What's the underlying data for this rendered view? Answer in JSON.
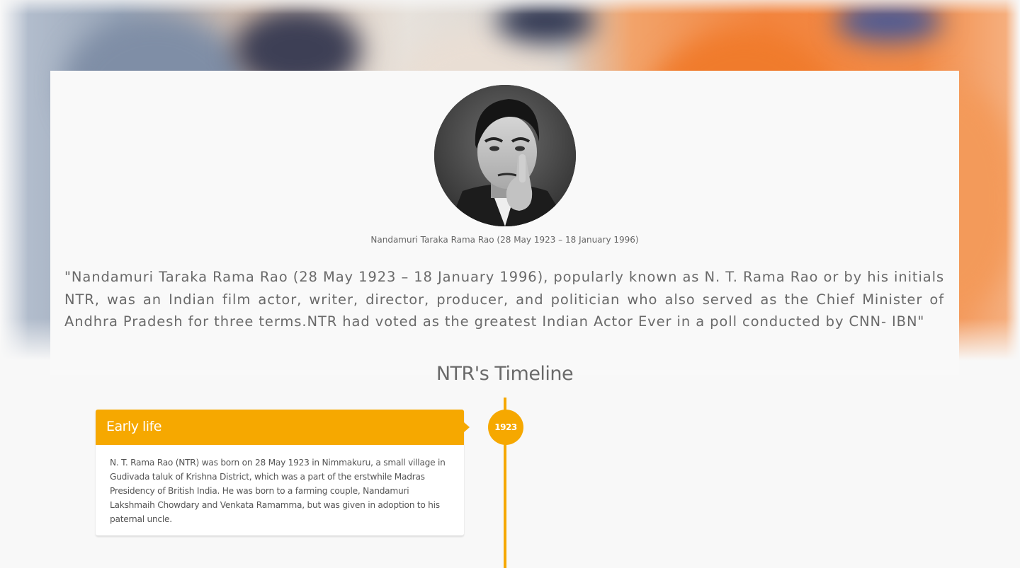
{
  "profile": {
    "caption": "Nandamuri Taraka Rama Rao (28 May 1923 – 18 January 1996)",
    "quote": "\"Nandamuri Taraka Rama Rao (28 May 1923 – 18 January 1996), popularly known as N. T. Rama Rao or by his initials NTR, was an Indian film actor, writer, director, producer, and politician who also served as the Chief Minister of Andhra Pradesh for three terms.NTR had voted as the greatest Indian Actor Ever in a poll conducted by CNN- IBN\""
  },
  "timeline": {
    "title": "NTR's Timeline",
    "accent": "#f6a800",
    "events": [
      {
        "year": "1923",
        "heading": "Early life",
        "body": "N. T. Rama Rao (NTR) was born on 28 May 1923 in Nimmakuru, a small village in Gudivada taluk of Krishna District, which was a part of the erstwhile Madras Presidency of British India. He was born to a farming couple, Nandamuri Lakshmaih Chowdary and Venkata Ramamma, but was given in adoption to his paternal uncle."
      }
    ]
  }
}
